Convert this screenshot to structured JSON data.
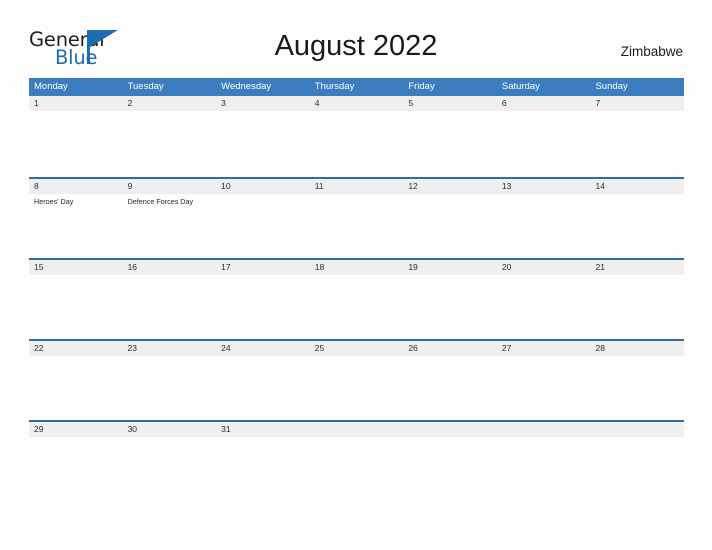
{
  "brand": {
    "name_part1": "General",
    "name_part2": "Blue",
    "accent_color": "#1f6cb0",
    "triangle_icon": "triangle-icon"
  },
  "header": {
    "title": "August 2022",
    "country": "Zimbabwe"
  },
  "theme": {
    "header_blue": "#3b7dbe",
    "rule_blue": "#2e6da4",
    "band_gray": "#f0efef",
    "text_dark": "#2b2b2b",
    "page_background": "#fdfdfd"
  },
  "calendar": {
    "month": "August",
    "year": "2022",
    "week_start": "Monday",
    "weekdays": [
      "Monday",
      "Tuesday",
      "Wednesday",
      "Thursday",
      "Friday",
      "Saturday",
      "Sunday"
    ],
    "weeks": [
      {
        "days": [
          {
            "num": "1",
            "event": ""
          },
          {
            "num": "2",
            "event": ""
          },
          {
            "num": "3",
            "event": ""
          },
          {
            "num": "4",
            "event": ""
          },
          {
            "num": "5",
            "event": ""
          },
          {
            "num": "6",
            "event": ""
          },
          {
            "num": "7",
            "event": ""
          }
        ]
      },
      {
        "days": [
          {
            "num": "8",
            "event": "Heroes' Day"
          },
          {
            "num": "9",
            "event": "Defence Forces Day"
          },
          {
            "num": "10",
            "event": ""
          },
          {
            "num": "11",
            "event": ""
          },
          {
            "num": "12",
            "event": ""
          },
          {
            "num": "13",
            "event": ""
          },
          {
            "num": "14",
            "event": ""
          }
        ]
      },
      {
        "days": [
          {
            "num": "15",
            "event": ""
          },
          {
            "num": "16",
            "event": ""
          },
          {
            "num": "17",
            "event": ""
          },
          {
            "num": "18",
            "event": ""
          },
          {
            "num": "19",
            "event": ""
          },
          {
            "num": "20",
            "event": ""
          },
          {
            "num": "21",
            "event": ""
          }
        ]
      },
      {
        "days": [
          {
            "num": "22",
            "event": ""
          },
          {
            "num": "23",
            "event": ""
          },
          {
            "num": "24",
            "event": ""
          },
          {
            "num": "25",
            "event": ""
          },
          {
            "num": "26",
            "event": ""
          },
          {
            "num": "27",
            "event": ""
          },
          {
            "num": "28",
            "event": ""
          }
        ]
      },
      {
        "days": [
          {
            "num": "29",
            "event": ""
          },
          {
            "num": "30",
            "event": ""
          },
          {
            "num": "31",
            "event": ""
          },
          {
            "num": "",
            "event": ""
          },
          {
            "num": "",
            "event": ""
          },
          {
            "num": "",
            "event": ""
          },
          {
            "num": "",
            "event": ""
          }
        ]
      }
    ]
  }
}
